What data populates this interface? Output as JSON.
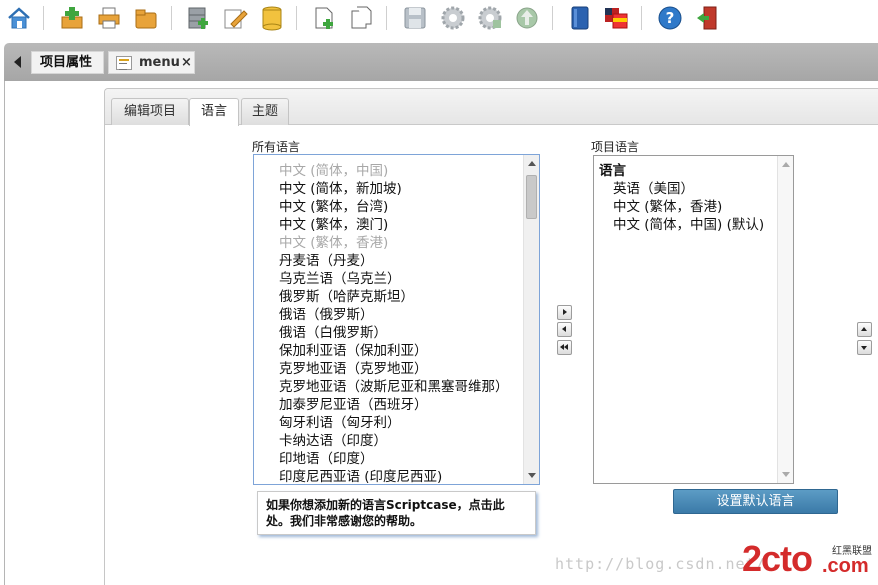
{
  "colors": {
    "accent": "#4a8bb9",
    "tabstrip": "#b0b0b0",
    "disabled_text": "#a8a8a8",
    "watermark": "#c9c9c9",
    "logo_red": "#d42b2b"
  },
  "toolbar": {
    "icons": [
      "home-icon",
      "add-icon",
      "print-icon",
      "folder-icon",
      "database-add-icon",
      "edit-icon",
      "database-icon",
      "new-document-icon",
      "copy-document-icon",
      "save-icon",
      "settings-icon",
      "settings-alt-icon",
      "export-icon",
      "book-icon",
      "language-flag-icon",
      "help-icon",
      "exit-icon"
    ]
  },
  "project_tabs": {
    "properties": "项目属性",
    "menu": "menu",
    "close": "×"
  },
  "sub_tabs": {
    "edit_project": "编辑项目",
    "language": "语言",
    "theme": "主题"
  },
  "all_languages": {
    "label": "所有语言",
    "items": [
      {
        "text": "中文 (简体，中国)",
        "disabled": true
      },
      {
        "text": "中文 (简体，新加坡)",
        "disabled": false
      },
      {
        "text": "中文 (繁体，台湾)",
        "disabled": false
      },
      {
        "text": "中文 (繁体，澳门)",
        "disabled": false
      },
      {
        "text": "中文 (繁体，香港)",
        "disabled": true
      },
      {
        "text": "丹麦语（丹麦）",
        "disabled": false
      },
      {
        "text": "乌克兰语（乌克兰）",
        "disabled": false
      },
      {
        "text": "俄罗斯（哈萨克斯坦）",
        "disabled": false
      },
      {
        "text": "俄语（俄罗斯）",
        "disabled": false
      },
      {
        "text": "俄语（白俄罗斯）",
        "disabled": false
      },
      {
        "text": "保加利亚语（保加利亚）",
        "disabled": false
      },
      {
        "text": "克罗地亚语（克罗地亚）",
        "disabled": false
      },
      {
        "text": "克罗地亚语（波斯尼亚和黑塞哥维那）",
        "disabled": false
      },
      {
        "text": "加泰罗尼亚语（西班牙）",
        "disabled": false
      },
      {
        "text": "匈牙利语（匈牙利）",
        "disabled": false
      },
      {
        "text": "卡纳达语（印度）",
        "disabled": false
      },
      {
        "text": "印地语（印度）",
        "disabled": false
      },
      {
        "text": "印度尼西亚语 (印度尼西亚)",
        "disabled": false
      }
    ]
  },
  "project_languages": {
    "label": "项目语言",
    "header": "语言",
    "items": [
      "英语（美国）",
      "中文 (繁体，香港)",
      "中文 (简体，中国) (默认)"
    ]
  },
  "buttons": {
    "set_default": "设置默认语言"
  },
  "help_text": "如果你想添加新的语言Scriptcase，点击此处。我们非常感谢您的帮助。",
  "watermark": {
    "url": "http://blog.csdn.net/",
    "logo_text": "2cto",
    "logo_suffix": ".com",
    "logo_tagline": "红黑联盟"
  }
}
